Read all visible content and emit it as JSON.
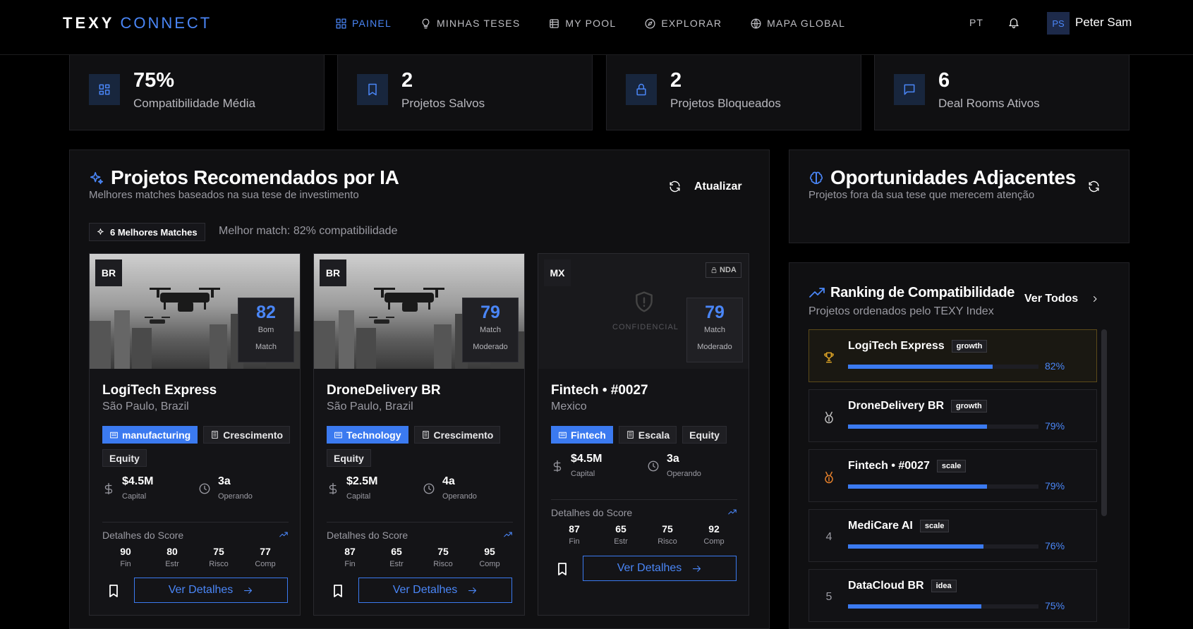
{
  "brand": {
    "primary": "TEXY",
    "secondary": "CONNECT"
  },
  "nav": [
    {
      "label": "PAINEL",
      "icon": "dashboard-icon",
      "active": true
    },
    {
      "label": "MINHAS TESES",
      "icon": "lightbulb-icon",
      "active": false
    },
    {
      "label": "MY POOL",
      "icon": "database-icon",
      "active": false
    },
    {
      "label": "EXPLORAR",
      "icon": "compass-icon",
      "active": false
    },
    {
      "label": "MAPA GLOBAL",
      "icon": "globe-icon",
      "active": false
    }
  ],
  "header": {
    "language": "PT",
    "avatar_initials": "PS",
    "user_name": "Peter Sam"
  },
  "stats": [
    {
      "value": "75%",
      "label": "Compatibilidade Média",
      "icon": "grid-icon"
    },
    {
      "value": "2",
      "label": "Projetos Salvos",
      "icon": "bookmark-icon"
    },
    {
      "value": "2",
      "label": "Projetos Bloqueados",
      "icon": "lock-icon"
    },
    {
      "value": "6",
      "label": "Deal Rooms Ativos",
      "icon": "chat-icon"
    }
  ],
  "recommended": {
    "title": "Projetos Recomendados por IA",
    "subtitle": "Melhores matches baseados na sua tese de investimento",
    "refresh_label": "Atualizar",
    "matches_badge": "6 Melhores Matches",
    "best_match": "Melhor match: 82% compatibilidade",
    "cards": [
      {
        "country": "BR",
        "score": "82",
        "score_l1": "Bom",
        "score_l2": "Match",
        "name": "LogiTech Express",
        "location": "São Paulo, Brazil",
        "tags": [
          "manufacturing",
          "Crescimento",
          "Equity"
        ],
        "capital": "$4.5M",
        "capital_label": "Capital",
        "years": "3a",
        "years_label": "Operando",
        "score_details_label": "Detalhes do Score",
        "scores": [
          {
            "n": "90",
            "l": "Fin"
          },
          {
            "n": "80",
            "l": "Estr"
          },
          {
            "n": "75",
            "l": "Risco"
          },
          {
            "n": "77",
            "l": "Comp"
          }
        ],
        "cta": "Ver Detalhes"
      },
      {
        "country": "BR",
        "score": "79",
        "score_l1": "Match",
        "score_l2": "Moderado",
        "name": "DroneDelivery BR",
        "location": "São Paulo, Brazil",
        "tags": [
          "Technology",
          "Crescimento",
          "Equity"
        ],
        "capital": "$2.5M",
        "capital_label": "Capital",
        "years": "4a",
        "years_label": "Operando",
        "score_details_label": "Detalhes do Score",
        "scores": [
          {
            "n": "87",
            "l": "Fin"
          },
          {
            "n": "65",
            "l": "Estr"
          },
          {
            "n": "75",
            "l": "Risco"
          },
          {
            "n": "95",
            "l": "Comp"
          }
        ],
        "cta": "Ver Detalhes"
      },
      {
        "country": "MX",
        "score": "79",
        "score_l1": "Match",
        "score_l2": "Moderado",
        "nda": "NDA",
        "confidential": "CONFIDENCIAL",
        "name": "Fintech • #0027",
        "location": "Mexico",
        "tags": [
          "Fintech",
          "Escala",
          "Equity"
        ],
        "capital": "$4.5M",
        "capital_label": "Capital",
        "years": "3a",
        "years_label": "Operando",
        "score_details_label": "Detalhes do Score",
        "scores": [
          {
            "n": "87",
            "l": "Fin"
          },
          {
            "n": "65",
            "l": "Estr"
          },
          {
            "n": "75",
            "l": "Risco"
          },
          {
            "n": "92",
            "l": "Comp"
          }
        ],
        "cta": "Ver Detalhes"
      }
    ]
  },
  "adjacent": {
    "title": "Oportunidades Adjacentes",
    "subtitle": "Projetos fora da sua tese que merecem atenção"
  },
  "ranking": {
    "title": "Ranking de Compatibilidade",
    "subtitle": "Projetos ordenados pelo TEXY Index",
    "view_all": "Ver Todos",
    "items": [
      {
        "rank": "1",
        "name": "LogiTech Express",
        "stage": "growth",
        "pct": "82%",
        "fill": 0.76,
        "rank_icon": "trophy-icon"
      },
      {
        "rank": "2",
        "name": "DroneDelivery BR",
        "stage": "growth",
        "pct": "79%",
        "fill": 0.73,
        "rank_icon": "medal-icon"
      },
      {
        "rank": "3",
        "name": "Fintech • #0027",
        "stage": "scale",
        "pct": "79%",
        "fill": 0.73,
        "rank_icon": "medal-icon"
      },
      {
        "rank": "4",
        "name": "MediCare AI",
        "stage": "scale",
        "pct": "76%",
        "fill": 0.71,
        "rank_icon": ""
      },
      {
        "rank": "5",
        "name": "DataCloud BR",
        "stage": "idea",
        "pct": "75%",
        "fill": 0.7,
        "rank_icon": ""
      }
    ]
  },
  "colors": {
    "accent": "#4a86f7",
    "background": "#000000",
    "panel": "#101012",
    "gold": "#e0a526",
    "bronze": "#e07d2a",
    "silver": "#bbbbbb"
  }
}
